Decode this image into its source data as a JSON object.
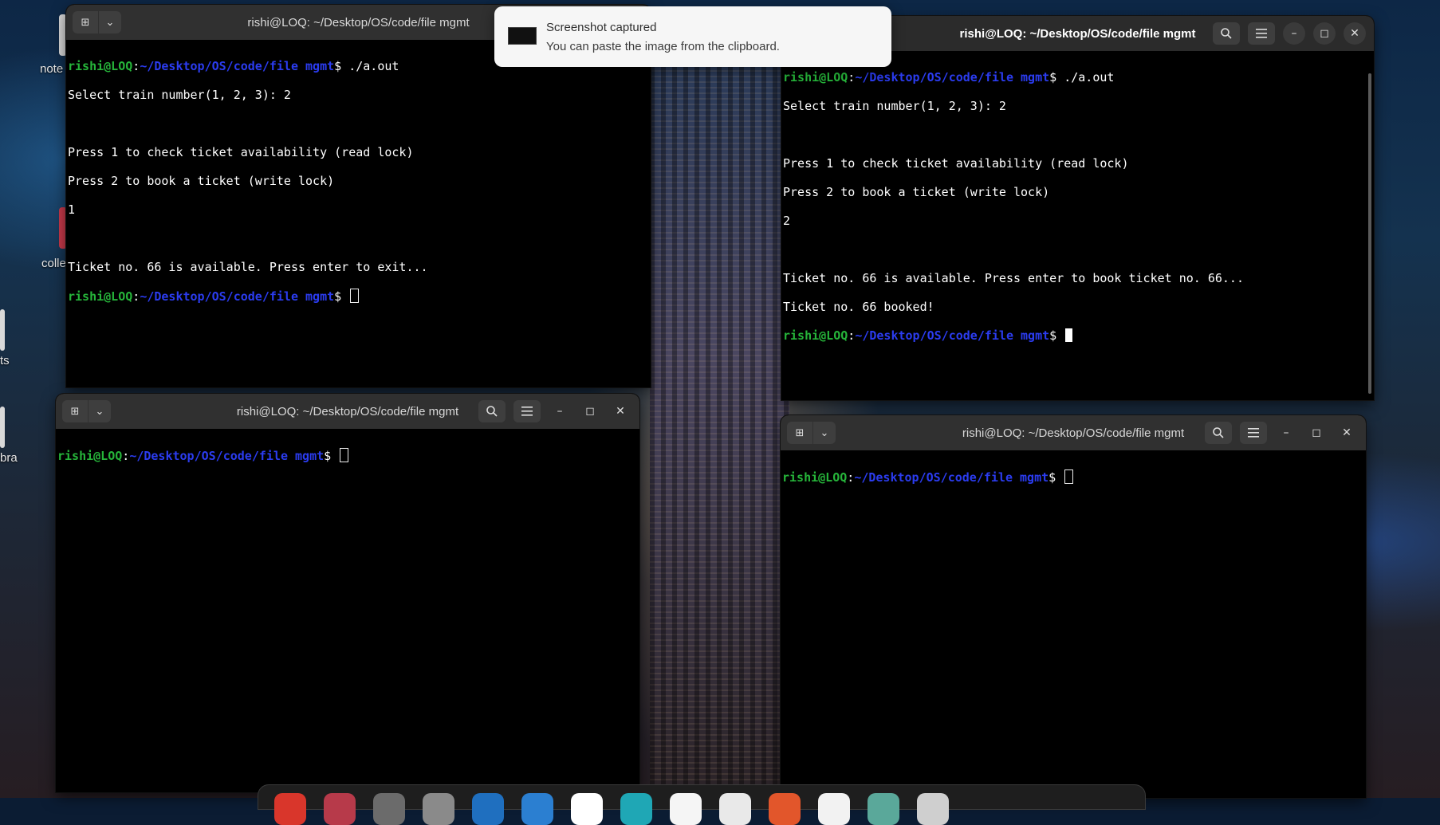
{
  "desktop": {
    "icons": [
      {
        "label": "note",
        "color": "#d9d9d9"
      },
      {
        "label": "colle",
        "color": "#c8394a"
      },
      {
        "label": "ts",
        "color": "#d9d9d9"
      },
      {
        "label": "bra",
        "color": "#d9d9d9"
      }
    ]
  },
  "notification": {
    "title": "Screenshot captured",
    "body": "You can paste the image from the clipboard."
  },
  "prompt": {
    "user": "rishi@LOQ",
    "colon": ":",
    "path": "~/Desktop/OS/code/file mgmt",
    "dollar": "$ "
  },
  "terminals": {
    "top_left": {
      "title": "rishi@LOQ: ~/Desktop/OS/code/file mgmt",
      "lines": {
        "cmd": "./a.out",
        "l1": "Select train number(1, 2, 3): 2",
        "l2": "",
        "l3": "Press 1 to check ticket availability (read lock)",
        "l4": "Press 2 to book a ticket (write lock)",
        "l5": "1",
        "l6": "",
        "l7": "Ticket no. 66 is available. Press enter to exit..."
      }
    },
    "top_right": {
      "title": "rishi@LOQ: ~/Desktop/OS/code/file mgmt",
      "lines": {
        "cmd": "./a.out",
        "l1": "Select train number(1, 2, 3): 2",
        "l2": "",
        "l3": "Press 1 to check ticket availability (read lock)",
        "l4": "Press 2 to book a ticket (write lock)",
        "l5": "2",
        "l6": "",
        "l7": "Ticket no. 66 is available. Press enter to book ticket no. 66...",
        "l8": "Ticket no. 66 booked!"
      }
    },
    "bottom_left": {
      "title": "rishi@LOQ: ~/Desktop/OS/code/file mgmt"
    },
    "bottom_right": {
      "title": "rishi@LOQ: ~/Desktop/OS/code/file mgmt"
    }
  },
  "icons": {
    "new_tab": "new-tab-icon",
    "dropdown": "chevron-down-icon",
    "search": "search-icon",
    "menu": "hamburger-menu-icon",
    "minimize": "minimize-icon",
    "maximize": "maximize-icon",
    "close": "close-icon"
  },
  "dock": {
    "apps": [
      "#d9362b",
      "#b73a4a",
      "#6b6b6b",
      "#8a8a8a",
      "#1f6fbf",
      "#2b7fd1",
      "#ffffff",
      "#1fa7b5",
      "#f5f5f5",
      "#e9e9e9",
      "#e2562b",
      "#f2f2f2",
      "#5aa89a",
      "#cfcfcf"
    ]
  },
  "colors": {
    "prompt_user": "#26b53a",
    "prompt_path": "#2b3cf0",
    "terminal_bg": "#000000",
    "titlebar_bg": "#303030"
  }
}
